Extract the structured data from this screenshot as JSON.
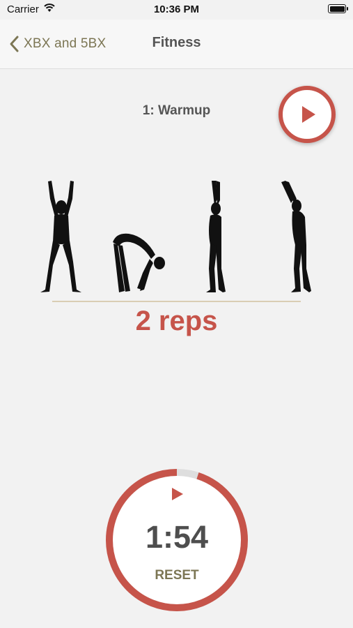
{
  "status_bar": {
    "carrier": "Carrier",
    "time": "10:36 PM"
  },
  "nav": {
    "back_label": "XBX and 5BX",
    "title": "Fitness"
  },
  "exercise": {
    "title": "1: Warmup",
    "reps": "2 reps"
  },
  "timer": {
    "time": "1:54",
    "reset_label": "RESET",
    "progress_fraction": 0.95
  },
  "colors": {
    "accent": "#c6544a",
    "olive": "#7c7654",
    "background": "#f2f2f2"
  }
}
